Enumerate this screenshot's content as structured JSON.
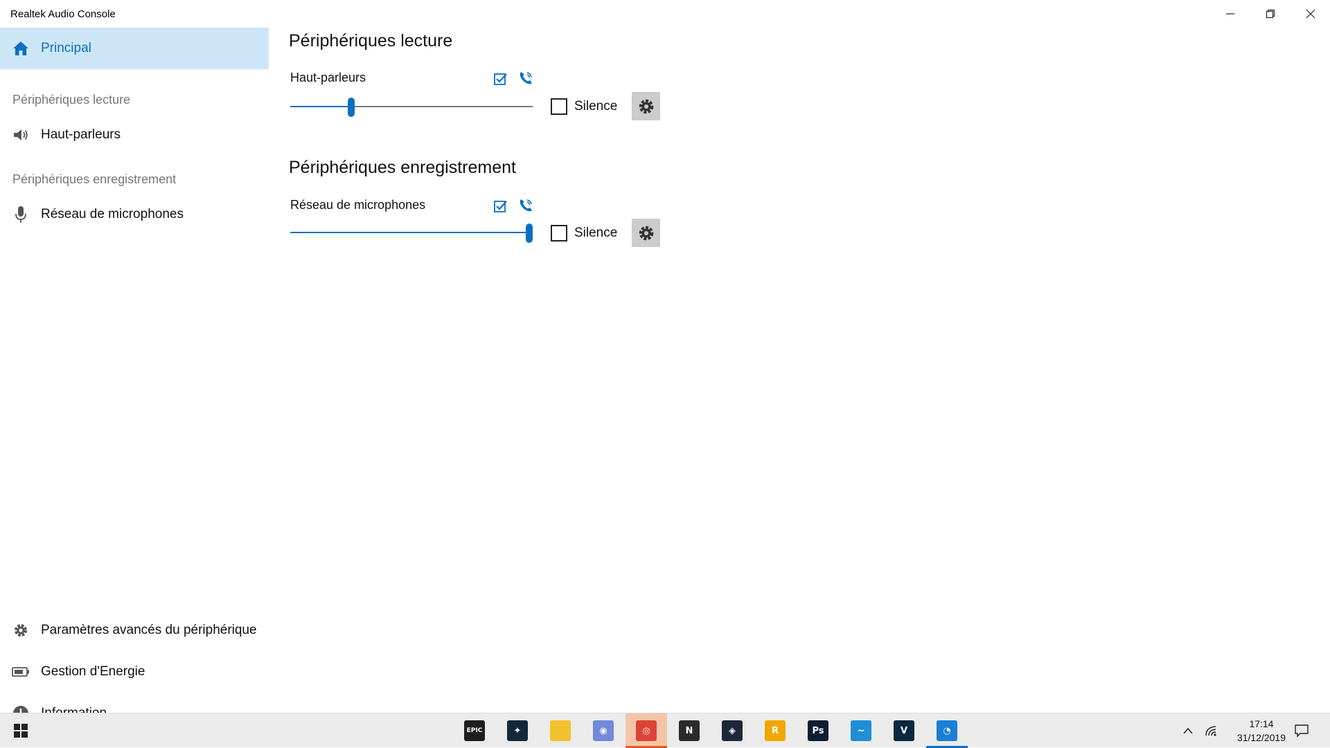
{
  "window": {
    "title": "Realtek Audio Console",
    "controls": [
      "minimize-icon",
      "restore-icon",
      "close-icon"
    ]
  },
  "sidebar": {
    "main_item": {
      "label": "Principal",
      "icon": "home-icon"
    },
    "playback_header": "Périphériques lecture",
    "playback_items": [
      {
        "label": "Haut-parleurs",
        "icon": "speaker-icon"
      }
    ],
    "recording_header": "Périphériques enregistrement",
    "recording_items": [
      {
        "label": "Réseau de microphones",
        "icon": "microphone-icon"
      }
    ],
    "bottom_items": [
      {
        "label": "Paramètres avancés du périphérique",
        "icon": "gear-icon"
      },
      {
        "label": "Gestion d'Energie",
        "icon": "battery-icon"
      },
      {
        "label": "Information",
        "icon": "info-icon"
      }
    ]
  },
  "main": {
    "playback": {
      "heading": "Périphériques lecture",
      "device": {
        "name": "Haut-parleurs",
        "volume_fraction": 0.25,
        "mute_label": "Silence",
        "muted": false
      }
    },
    "recording": {
      "heading": "Périphériques enregistrement",
      "device": {
        "name": "Réseau de microphones",
        "volume_fraction": 1.0,
        "mute_label": "Silence",
        "muted": false
      }
    }
  },
  "taskbar": {
    "apps": [
      {
        "name": "Epic Games",
        "icon": "epic-games-icon",
        "glyph": "EPIC",
        "color": "#1e1e1e"
      },
      {
        "name": "Battle.net",
        "icon": "battlenet-icon",
        "glyph": "✦",
        "color": "#14283c"
      },
      {
        "name": "File Explorer",
        "icon": "folder-icon",
        "glyph": "",
        "color": "#f2c12e"
      },
      {
        "name": "Discord",
        "icon": "discord-icon",
        "glyph": "◉",
        "color": "#7289da"
      },
      {
        "name": "Chrome",
        "icon": "chrome-icon",
        "glyph": "◎",
        "color": "#db4437"
      },
      {
        "name": "Notion",
        "icon": "notion-icon",
        "glyph": "N",
        "color": "#2b2b2b"
      },
      {
        "name": "Steam",
        "icon": "steam-icon",
        "glyph": "◈",
        "color": "#1b2838"
      },
      {
        "name": "Rockstar",
        "icon": "rockstar-icon",
        "glyph": "R",
        "color": "#f0a800"
      },
      {
        "name": "Photoshop",
        "icon": "photoshop-icon",
        "glyph": "Ps",
        "color": "#0c1e33"
      },
      {
        "name": "Swift",
        "icon": "swift-icon",
        "glyph": "~",
        "color": "#1f8fd6"
      },
      {
        "name": "V",
        "icon": "v-app-icon",
        "glyph": "V",
        "color": "#0a2a40"
      },
      {
        "name": "Realtek Audio Console",
        "icon": "realtek-icon",
        "glyph": "◔",
        "color": "#1a7fd6"
      }
    ],
    "time": "17:14",
    "date": "31/12/2019"
  }
}
